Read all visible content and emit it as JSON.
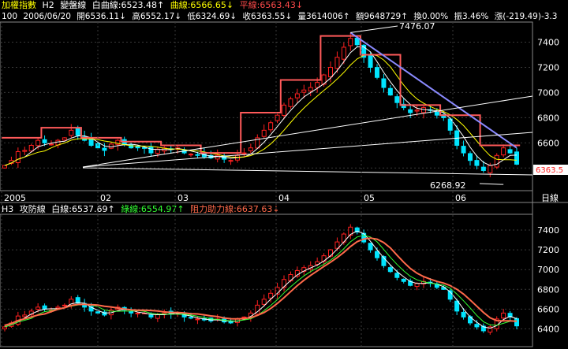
{
  "top_header": {
    "index_name": "加權指數",
    "panel": "H2",
    "indicator": "變盤線",
    "white_label": "白曲線:6523.48↑",
    "curve_label": "曲線:6566.65↓",
    "flat_label": "平線:6563.43↓"
  },
  "quote_line": {
    "period": "100",
    "date": "2006/06/20",
    "open": "開6536.11↓",
    "high": "高6552.17↓",
    "low": "低6324.69↓",
    "close": "收6363.55↓",
    "volume": "量3614006↑",
    "amount": "額9648729↑",
    "turnover": "換0.00%",
    "amplitude": "振3.46%",
    "change": "漲(-219.49)-3.3"
  },
  "bottom_header": {
    "panel": "H3",
    "indicator": "攻防線",
    "white_label": "白線:6537.69↑",
    "green_label": "綠線:6554.97↑",
    "resist_label": "阻力助力線:6637.63↓"
  },
  "period_button": "日線",
  "last_price_tag": "6363.5",
  "colors": {
    "up": "#ff2020",
    "down": "#00e5ff",
    "resist": "#ff5a5a",
    "trend": "#8a8aff"
  },
  "chart_data": [
    {
      "type": "candlestick",
      "title": "變盤線",
      "x_ticks": [
        "2005",
        "02",
        "03",
        "04",
        "05",
        "06"
      ],
      "y_ticks": [
        6400,
        6600,
        6800,
        7000,
        7200,
        7400
      ],
      "ylim": [
        6220,
        7560
      ],
      "annotations": [
        {
          "text": "7476.07"
        },
        {
          "text": "6268.92"
        }
      ],
      "close_series": [
        6420,
        6460,
        6530,
        6540,
        6580,
        6620,
        6600,
        6590,
        6620,
        6640,
        6700,
        6660,
        6620,
        6580,
        6560,
        6540,
        6590,
        6620,
        6590,
        6560,
        6560,
        6560,
        6520,
        6550,
        6560,
        6550,
        6560,
        6520,
        6510,
        6500,
        6490,
        6480,
        6500,
        6470,
        6460,
        6500,
        6520,
        6560,
        6640,
        6700,
        6760,
        6820,
        6900,
        6950,
        6990,
        7020,
        7040,
        7080,
        7140,
        7200,
        7280,
        7360,
        7430,
        7380,
        7280,
        7200,
        7120,
        7040,
        6980,
        6920,
        6880,
        6840,
        6860,
        6880,
        6860,
        6820,
        6800,
        6700,
        6580,
        6520,
        6460,
        6420,
        6380,
        6420,
        6500,
        6560,
        6520,
        6430
      ]
    },
    {
      "type": "candlestick",
      "title": "攻防線",
      "y_ticks": [
        6400,
        6600,
        6800,
        7000,
        7200,
        7400
      ]
    }
  ]
}
